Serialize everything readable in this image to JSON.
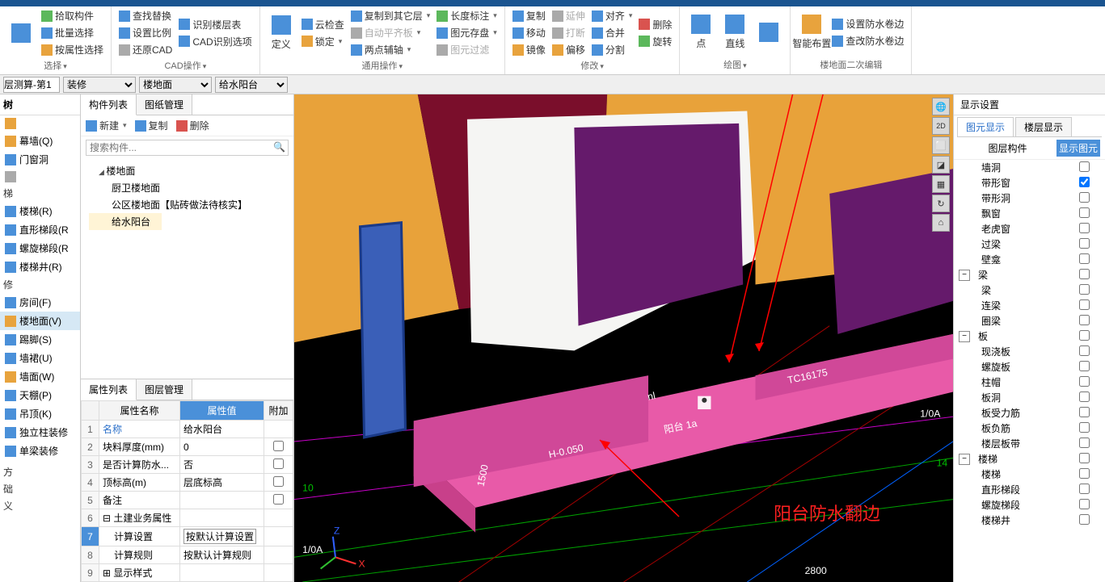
{
  "ribbon": {
    "group1": {
      "pick": "拾取构件",
      "batch": "批量选择",
      "attr": "按属性选择",
      "label": "选择"
    },
    "group2": {
      "find": "查找替换",
      "scale": "设置比例",
      "restore": "还原CAD",
      "identify": "识别楼层表",
      "option": "CAD识别选项",
      "label": "CAD操作"
    },
    "group3": {
      "define": "定义",
      "cloud": "云检查",
      "lock": "锁定",
      "copyother": "复制到其它层",
      "autoflat": "自动平齐板",
      "twopoint": "两点辅轴",
      "length": "长度标注",
      "imgstore": "图元存盘",
      "imgfilter": "图元过滤",
      "label": "通用操作"
    },
    "group4": {
      "copy": "复制",
      "move": "移动",
      "mirror": "镜像",
      "extend": "延伸",
      "break": "打断",
      "offset": "偏移",
      "align": "对齐",
      "merge": "合并",
      "split": "分割",
      "delete": "删除",
      "rotate": "旋转",
      "label": "修改"
    },
    "group5": {
      "point": "点",
      "line": "直线",
      "rect": "",
      "label": "绘图"
    },
    "group6": {
      "smart": "智能布置",
      "setwp": "设置防水卷边",
      "viewwp": "查改防水卷边",
      "label": "楼地面二次编辑"
    }
  },
  "selectors": {
    "calc": "层测算-第1",
    "s1": "装修",
    "s2": "楼地面",
    "s3": "给水阳台"
  },
  "leftnav": {
    "title": "树",
    "items_top": [
      {
        "icon": "i-orange",
        "label": ""
      },
      {
        "icon": "i-orange",
        "label": "幕墙(Q)"
      },
      {
        "icon": "i-blue",
        "label": "门窗洞"
      },
      {
        "icon": "i-grey",
        "label": ""
      }
    ],
    "items_stair_hdr": "梯",
    "items_stair": [
      {
        "icon": "i-blue",
        "label": "楼梯(R)"
      },
      {
        "icon": "i-blue",
        "label": "直形梯段(R"
      },
      {
        "icon": "i-blue",
        "label": "螺旋梯段(R"
      },
      {
        "icon": "i-blue",
        "label": "楼梯井(R)"
      }
    ],
    "items_fin_hdr": "修",
    "items_fin": [
      {
        "icon": "i-blue",
        "label": "房间(F)"
      },
      {
        "icon": "i-orange",
        "label": "楼地面(V)",
        "active": true
      },
      {
        "icon": "i-blue",
        "label": "踢脚(S)"
      },
      {
        "icon": "i-blue",
        "label": "墙裙(U)"
      },
      {
        "icon": "i-orange",
        "label": "墙面(W)"
      },
      {
        "icon": "i-blue",
        "label": "天棚(P)"
      },
      {
        "icon": "i-blue",
        "label": "吊顶(K)"
      },
      {
        "icon": "i-blue",
        "label": "独立柱装修"
      },
      {
        "icon": "i-blue",
        "label": "单梁装修"
      }
    ],
    "items_bottom": [
      "方",
      "础",
      "义"
    ]
  },
  "components": {
    "tab1": "构件列表",
    "tab2": "图纸管理",
    "new": "新建",
    "copy": "复制",
    "delete": "删除",
    "search_ph": "搜索构件...",
    "root": "楼地面",
    "children": [
      "厨卫楼地面",
      "公区楼地面【贴砖做法待核实】",
      "给水阳台"
    ]
  },
  "props": {
    "tab1": "属性列表",
    "tab2": "图层管理",
    "h_name": "属性名称",
    "h_val": "属性值",
    "h_addon": "附加",
    "rows": [
      {
        "i": "1",
        "name": "名称",
        "val": "给水阳台",
        "link": true
      },
      {
        "i": "2",
        "name": "块料厚度(mm)",
        "val": "0",
        "cb": true
      },
      {
        "i": "3",
        "name": "是否计算防水...",
        "val": "否",
        "cb": true
      },
      {
        "i": "4",
        "name": "顶标高(m)",
        "val": "层底标高",
        "cb": true
      },
      {
        "i": "5",
        "name": "备注",
        "val": "",
        "cb": true
      },
      {
        "i": "6",
        "name": "土建业务属性",
        "val": "",
        "grp": true
      },
      {
        "i": "7",
        "name": "计算设置",
        "val": "按默认计算设置",
        "boxed": true,
        "active": true
      },
      {
        "i": "8",
        "name": "计算规则",
        "val": "按默认计算规则"
      },
      {
        "i": "9",
        "name": "显示样式",
        "val": "",
        "grp": true
      }
    ]
  },
  "viewport": {
    "annot_text": "阳台防水翻边",
    "labels": {
      "h": "H-0.050",
      "bt": "阳台 1a",
      "n": "nl",
      "tc": "TC16175",
      "axis1": "1/0A",
      "axis2": "1/0A",
      "dim": "2800",
      "grid": "14",
      "dim2": "1500"
    }
  },
  "right": {
    "title": "显示设置",
    "tab1": "图元显示",
    "tab2": "楼层显示",
    "h1": "图层构件",
    "h2": "显示图元",
    "rows": [
      {
        "lbl": "墙洞",
        "indent": 2
      },
      {
        "lbl": "带形窗",
        "indent": 2,
        "checked": true
      },
      {
        "lbl": "带形洞",
        "indent": 2
      },
      {
        "lbl": "飘窗",
        "indent": 2
      },
      {
        "lbl": "老虎窗",
        "indent": 2
      },
      {
        "lbl": "过梁",
        "indent": 2
      },
      {
        "lbl": "壁龛",
        "indent": 2
      },
      {
        "lbl": "梁",
        "grp": true,
        "open": true
      },
      {
        "lbl": "梁",
        "indent": 2
      },
      {
        "lbl": "连梁",
        "indent": 2
      },
      {
        "lbl": "圈梁",
        "indent": 2
      },
      {
        "lbl": "板",
        "grp": true,
        "open": true,
        "cb": true
      },
      {
        "lbl": "现浇板",
        "indent": 2
      },
      {
        "lbl": "螺旋板",
        "indent": 2
      },
      {
        "lbl": "柱帽",
        "indent": 2
      },
      {
        "lbl": "板洞",
        "indent": 2
      },
      {
        "lbl": "板受力筋",
        "indent": 2
      },
      {
        "lbl": "板负筋",
        "indent": 2
      },
      {
        "lbl": "楼层板带",
        "indent": 2
      },
      {
        "lbl": "楼梯",
        "grp": true,
        "open": true
      },
      {
        "lbl": "楼梯",
        "indent": 2
      },
      {
        "lbl": "直形梯段",
        "indent": 2
      },
      {
        "lbl": "螺旋梯段",
        "indent": 2
      },
      {
        "lbl": "楼梯井",
        "indent": 2
      }
    ]
  }
}
